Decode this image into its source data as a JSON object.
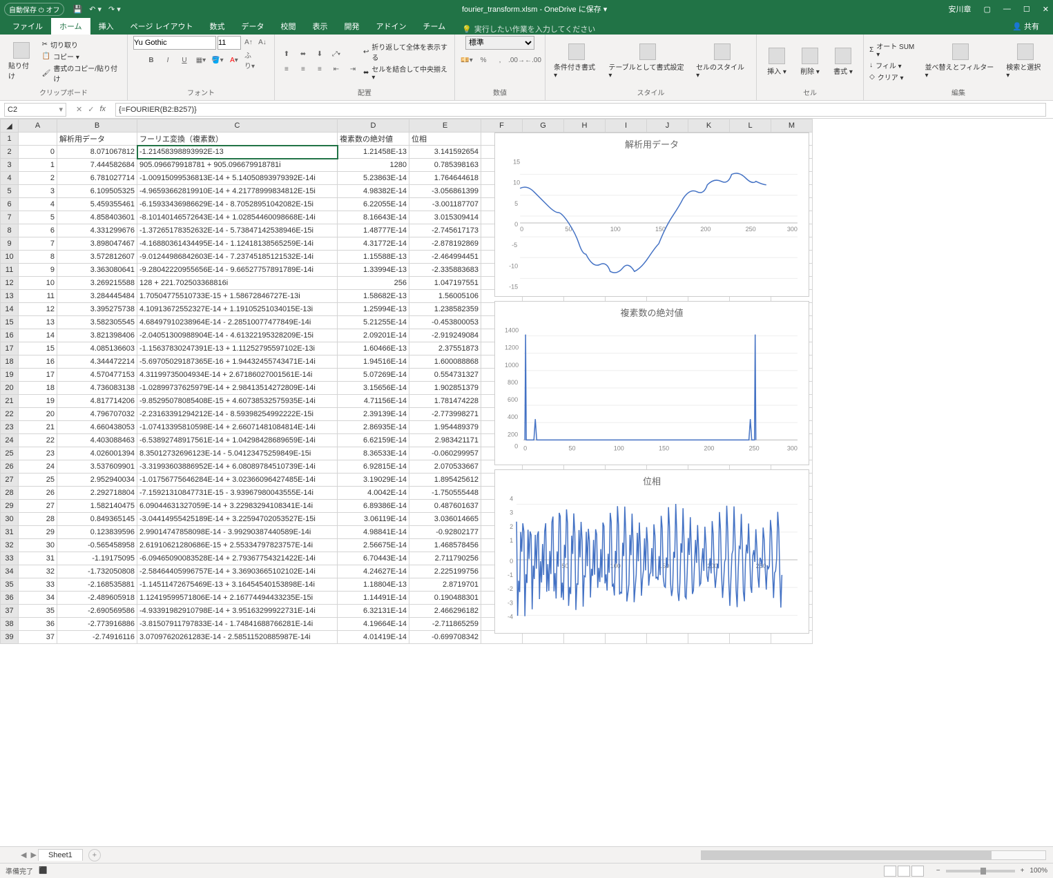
{
  "titlebar": {
    "autosave": "自動保存 ⏻ オフ",
    "filename": "fourier_transform.xlsm - OneDrive に保存 ▾",
    "user": "安川章"
  },
  "tabs": {
    "file": "ファイル",
    "home": "ホーム",
    "insert": "挿入",
    "layout": "ページ レイアウト",
    "formulas": "数式",
    "data": "データ",
    "review": "校閲",
    "view": "表示",
    "dev": "開発",
    "addins": "アドイン",
    "team": "チーム",
    "tell": "実行したい作業を入力してください",
    "share": "共有"
  },
  "ribbon": {
    "clipboard": {
      "paste": "貼り付け",
      "cut": "切り取り",
      "copy": "コピー ▾",
      "fmt": "書式のコピー/貼り付け",
      "label": "クリップボード"
    },
    "font": {
      "name": "Yu Gothic",
      "size": "11",
      "label": "フォント"
    },
    "align": {
      "wrap": "折り返して全体を表示する",
      "merge": "セルを結合して中央揃え ▾",
      "label": "配置"
    },
    "number": {
      "format": "標準",
      "label": "数値"
    },
    "styles": {
      "cond": "条件付き書式 ▾",
      "table": "テーブルとして書式設定 ▾",
      "cell": "セルのスタイル ▾",
      "label": "スタイル"
    },
    "cells": {
      "insert": "挿入 ▾",
      "delete": "削除 ▾",
      "format": "書式 ▾",
      "label": "セル"
    },
    "editing": {
      "sum": "オート SUM ▾",
      "fill": "フィル ▾",
      "clear": "クリア ▾",
      "sort": "並べ替えとフィルター ▾",
      "find": "検索と選択 ▾",
      "label": "編集"
    }
  },
  "namebox": "C2",
  "formula": "{=FOURIER(B2:B257)}",
  "columns": [
    "A",
    "B",
    "C",
    "D",
    "E",
    "F",
    "G",
    "H",
    "I",
    "J",
    "K",
    "L",
    "M"
  ],
  "headers": {
    "B": "解析用データ",
    "C": "フーリエ変換（複素数）",
    "D": "複素数の絶対値",
    "E": "位相"
  },
  "rows": [
    {
      "r": 2,
      "A": "0",
      "B": "8.071067812",
      "C": "-1.21458398893992E-13",
      "D": "1.21458E-13",
      "E": "3.141592654"
    },
    {
      "r": 3,
      "A": "1",
      "B": "7.444582684",
      "C": "905.096679918781 +  905.096679918781i",
      "D": "1280",
      "E": "0.785398163"
    },
    {
      "r": 4,
      "A": "2",
      "B": "6.781027714",
      "C": "-1.00915099536813E-14 +  5.14050893979392E-14i",
      "D": "5.23863E-14",
      "E": "1.764644618"
    },
    {
      "r": 5,
      "A": "3",
      "B": "6.109505325",
      "C": "-4.96593662819910E-14 +  4.21778999834812E-15i",
      "D": "4.98382E-14",
      "E": "-3.056861399"
    },
    {
      "r": 6,
      "A": "4",
      "B": "5.459355461",
      "C": "-6.15933436986629E-14 -  8.70528951042082E-15i",
      "D": "6.22055E-14",
      "E": "-3.001187707"
    },
    {
      "r": 7,
      "A": "5",
      "B": "4.858403601",
      "C": "-8.10140146572643E-14 +  1.02854460098668E-14i",
      "D": "8.16643E-14",
      "E": "3.015309414"
    },
    {
      "r": 8,
      "A": "6",
      "B": "4.331299676",
      "C": "-1.37265178352632E-14 -  5.73847142538946E-15i",
      "D": "1.48777E-14",
      "E": "-2.745617173"
    },
    {
      "r": 9,
      "A": "7",
      "B": "3.898047467",
      "C": "-4.16880361434495E-14 -  1.12418138565259E-14i",
      "D": "4.31772E-14",
      "E": "-2.878192869"
    },
    {
      "r": 10,
      "A": "8",
      "B": "3.572812607",
      "C": "-9.01244986842603E-14 -  7.23745185121532E-14i",
      "D": "1.15588E-13",
      "E": "-2.464994451"
    },
    {
      "r": 11,
      "A": "9",
      "B": "3.363080641",
      "C": "-9.28042220955656E-14 -  9.66527757891789E-14i",
      "D": "1.33994E-13",
      "E": "-2.335883683"
    },
    {
      "r": 12,
      "A": "10",
      "B": "3.269215588",
      "C": "128 +  221.702503368816i",
      "D": "256",
      "E": "1.047197551"
    },
    {
      "r": 13,
      "A": "11",
      "B": "3.284445484",
      "C": "1.70504775510733E-15 +  1.58672846727E-13i",
      "D": "1.58682E-13",
      "E": "1.56005106"
    },
    {
      "r": 14,
      "A": "12",
      "B": "3.395275738",
      "C": "4.10913672552327E-14 +  1.19105251034015E-13i",
      "D": "1.25994E-13",
      "E": "1.238582359"
    },
    {
      "r": 15,
      "A": "13",
      "B": "3.582305545",
      "C": "4.68497910238964E-14 -  2.28510077477849E-14i",
      "D": "5.21255E-14",
      "E": "-0.453800053"
    },
    {
      "r": 16,
      "A": "14",
      "B": "3.821398406",
      "C": "-2.04051300988904E-14 -  4.61322195328209E-15i",
      "D": "2.09201E-14",
      "E": "-2.919249084"
    },
    {
      "r": 17,
      "A": "15",
      "B": "4.085136603",
      "C": "-1.15637830247391E-13 +  1.11252795597102E-13i",
      "D": "1.60466E-13",
      "E": "2.37551873"
    },
    {
      "r": 18,
      "A": "16",
      "B": "4.344472214",
      "C": "-5.69705029187365E-16 +  1.94432455743471E-14i",
      "D": "1.94516E-14",
      "E": "1.600088868"
    },
    {
      "r": 19,
      "A": "17",
      "B": "4.570477153",
      "C": "4.31199735004934E-14 +  2.67186027001561E-14i",
      "D": "5.07269E-14",
      "E": "0.554731327"
    },
    {
      "r": 20,
      "A": "18",
      "B": "4.736083138",
      "C": "-1.02899737625979E-14 +  2.98413514272809E-14i",
      "D": "3.15656E-14",
      "E": "1.902851379"
    },
    {
      "r": 21,
      "A": "19",
      "B": "4.817714206",
      "C": "-9.85295078085408E-15 +  4.60738532575935E-14i",
      "D": "4.71156E-14",
      "E": "1.781474228"
    },
    {
      "r": 22,
      "A": "20",
      "B": "4.796707032",
      "C": "-2.23163391294212E-14 -  8.59398254992222E-15i",
      "D": "2.39139E-14",
      "E": "-2.773998271"
    },
    {
      "r": 23,
      "A": "21",
      "B": "4.660438053",
      "C": "-1.07413395810598E-14 +  2.66071481084814E-14i",
      "D": "2.86935E-14",
      "E": "1.954489379"
    },
    {
      "r": 24,
      "A": "22",
      "B": "4.403088463",
      "C": "-6.53892748917561E-14 +  1.04298428689659E-14i",
      "D": "6.62159E-14",
      "E": "2.983421171"
    },
    {
      "r": 25,
      "A": "23",
      "B": "4.026001394",
      "C": "8.35012732696123E-14 -  5.04123475259849E-15i",
      "D": "8.36533E-14",
      "E": "-0.060299957"
    },
    {
      "r": 26,
      "A": "24",
      "B": "3.537609901",
      "C": "-3.31993603886952E-14 +  6.08089784510739E-14i",
      "D": "6.92815E-14",
      "E": "2.070533667"
    },
    {
      "r": 27,
      "A": "25",
      "B": "2.952940034",
      "C": "-1.01756775646284E-14 +  3.02366096427485E-14i",
      "D": "3.19029E-14",
      "E": "1.895425612"
    },
    {
      "r": 28,
      "A": "26",
      "B": "2.292718804",
      "C": "-7.15921310847731E-15 -  3.93967980043555E-14i",
      "D": "4.0042E-14",
      "E": "-1.750555448"
    },
    {
      "r": 29,
      "A": "27",
      "B": "1.582140475",
      "C": "6.09044631327059E-14 +  3.22983294108341E-14i",
      "D": "6.89386E-14",
      "E": "0.487601637"
    },
    {
      "r": 30,
      "A": "28",
      "B": "0.849365145",
      "C": "-3.04414955425189E-14 +  3.22594702053527E-15i",
      "D": "3.06119E-14",
      "E": "3.036014665"
    },
    {
      "r": 31,
      "A": "29",
      "B": "0.123839596",
      "C": "2.99014747858098E-14 -  3.99290387440589E-14i",
      "D": "4.98841E-14",
      "E": "-0.92802177"
    },
    {
      "r": 32,
      "A": "30",
      "B": "-0.565458958",
      "C": "2.61910621280686E-15 +  2.55334797823757E-14i",
      "D": "2.56675E-14",
      "E": "1.468578456"
    },
    {
      "r": 33,
      "A": "31",
      "B": "-1.19175095",
      "C": "-6.09465090083528E-14 +  2.79367754321422E-14i",
      "D": "6.70443E-14",
      "E": "2.711790256"
    },
    {
      "r": 34,
      "A": "32",
      "B": "-1.732050808",
      "C": "-2.58464405996757E-14 +  3.36903665102102E-14i",
      "D": "4.24627E-14",
      "E": "2.225199756"
    },
    {
      "r": 35,
      "A": "33",
      "B": "-2.168535881",
      "C": "-1.14511472675469E-13 +  3.16454540153898E-14i",
      "D": "1.18804E-13",
      "E": "2.8719701"
    },
    {
      "r": 36,
      "A": "34",
      "B": "-2.489605918",
      "C": "1.12419599571806E-14 +  2.16774494433235E-15i",
      "D": "1.14491E-14",
      "E": "0.190488301"
    },
    {
      "r": 37,
      "A": "35",
      "B": "-2.690569586",
      "C": "-4.93391982910798E-14 +  3.95163299922731E-14i",
      "D": "6.32131E-14",
      "E": "2.466296182"
    },
    {
      "r": 38,
      "A": "36",
      "B": "-2.773916886",
      "C": "-3.81507911797833E-14 -  1.74841688766281E-14i",
      "D": "4.19664E-14",
      "E": "-2.711865259"
    },
    {
      "r": 39,
      "A": "37",
      "B": "-2.74916116",
      "C": "3.07097620261283E-14 -  2.58511520885987E-14i",
      "D": "4.01419E-14",
      "E": "-0.699708342"
    }
  ],
  "charts": [
    {
      "title": "解析用データ",
      "ticks_x": [
        0,
        50,
        100,
        150,
        200,
        250,
        300
      ],
      "ticks_y": [
        -15,
        -10,
        -5,
        0,
        5,
        10,
        15
      ]
    },
    {
      "title": "複素数の絶対値",
      "ticks_x": [
        0,
        50,
        100,
        150,
        200,
        250,
        300
      ],
      "ticks_y": [
        0,
        200,
        400,
        600,
        800,
        1000,
        1200,
        1400
      ]
    },
    {
      "title": "位相",
      "ticks_x": [
        50,
        100,
        150,
        200,
        250
      ],
      "ticks_y": [
        -4,
        -3,
        -2,
        -1,
        0,
        1,
        2,
        3,
        4
      ]
    }
  ],
  "sheet_tab": "Sheet1",
  "status": {
    "ready": "準備完了",
    "zoom": "100%"
  }
}
